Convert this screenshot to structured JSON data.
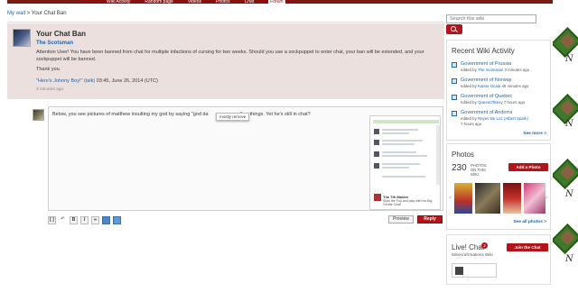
{
  "topnav": {
    "items": [
      "Wiki Activity",
      "Random page",
      "Videos",
      "Photos",
      "Chat",
      "Forum"
    ],
    "active_index": 5
  },
  "breadcrumb": {
    "wall_link": "My wall",
    "separator": ">",
    "current": "Your Chat Ban"
  },
  "thread": {
    "title": "Your Chat Ban",
    "author": "The Scotsman",
    "body": "Attention User! You have been banned from chat for multiple infactions of cursing for two weeks. Should you use a sockpuppet to enter chat, your ban will be extended, and your sockpuppet will be banned.",
    "thanks": "Thank you.",
    "signature_link": "\"Here's Johnny Boy!\" (talk)",
    "signature_time": "03:45, June 26, 2014 (UTC)",
    "posted_ago": "3 minutes ago"
  },
  "reply": {
    "text_before": "Below, you see pictures of matthew insulting my god by saying \"god da",
    "text_after": "other things. Yet he's still in chat?",
    "tooltip": "mostly remove",
    "thumb_name": "The 7th Master",
    "thumb_sub": "Slips the Fuji and play with his Big Gentle Chat!",
    "preview_label": "Preview",
    "reply_label": "Reply"
  },
  "toolbar": {
    "source": "[ ]",
    "bold": "B",
    "italic": "I"
  },
  "search": {
    "placeholder": "Search this wiki"
  },
  "activity": {
    "title": "Recent Wiki Activity",
    "items": [
      {
        "title": "Government of Prussia",
        "by": "edited by",
        "who": "The Scotsman",
        "when": "3 minutes ago"
      },
      {
        "title": "Government of Norway",
        "by": "edited by",
        "who": "Kaiser Ocaia",
        "when": "46 minutes ago"
      },
      {
        "title": "Government of Quebec",
        "by": "edited by",
        "who": "QueenOfSexy",
        "when": "7 hours ago"
      },
      {
        "title": "Government of Andorra",
        "by": "edited by",
        "who": "Reyes De Luz (Albert Spark)",
        "when": "7 hours ago"
      }
    ],
    "see_more": "See more >"
  },
  "photos": {
    "title": "Photos",
    "count": "230",
    "count_label": "PHOTOS ON THIS WIKI",
    "add_button": "Add a Photo",
    "see_all": "See all photos >",
    "prev": "<",
    "next": ">"
  },
  "chat": {
    "title": "Live! Chat",
    "badge": "2",
    "subtitle": "Minecraft Nations Wiki",
    "join_button": "Join the Chat"
  },
  "background": {
    "label": "N"
  },
  "colors": {
    "brand_red": "#b3141b",
    "link_blue": "#2266aa",
    "thread_bg": "#ece0df"
  }
}
